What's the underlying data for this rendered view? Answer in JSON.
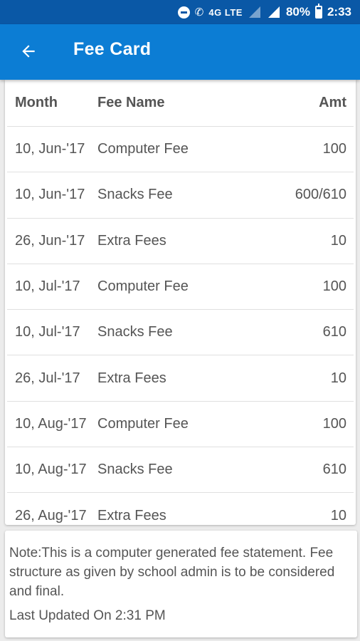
{
  "status_bar": {
    "network_label": "4G",
    "lte_label": "LTE",
    "battery": "80%",
    "time": "2:33"
  },
  "app_bar": {
    "title": "Fee Card"
  },
  "table": {
    "headers": {
      "month": "Month",
      "fee_name": "Fee Name",
      "amount": "Amt"
    },
    "rows": [
      {
        "month": "10, Jun-'17",
        "fee_name": "Computer Fee",
        "amount": "100"
      },
      {
        "month": "10, Jun-'17",
        "fee_name": "Snacks Fee",
        "amount": "600/610"
      },
      {
        "month": "26, Jun-'17",
        "fee_name": "Extra Fees",
        "amount": "10"
      },
      {
        "month": "10, Jul-'17",
        "fee_name": "Computer Fee",
        "amount": "100"
      },
      {
        "month": "10, Jul-'17",
        "fee_name": "Snacks Fee",
        "amount": "610"
      },
      {
        "month": "26, Jul-'17",
        "fee_name": "Extra Fees",
        "amount": "10"
      },
      {
        "month": "10, Aug-'17",
        "fee_name": "Computer Fee",
        "amount": "100"
      },
      {
        "month": "10, Aug-'17",
        "fee_name": "Snacks Fee",
        "amount": "610"
      },
      {
        "month": "26, Aug-'17",
        "fee_name": "Extra Fees",
        "amount": "10"
      }
    ]
  },
  "note": {
    "text": "Note:This is a computer generated fee statement. Fee structure as given by school admin is to be considered and final.",
    "last_updated": "Last Updated On 2:31 PM"
  }
}
